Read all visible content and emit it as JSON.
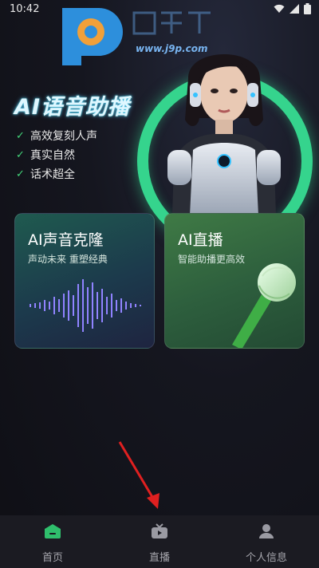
{
  "status_bar": {
    "time": "10:42"
  },
  "watermark": {
    "url": "www.j9p.com"
  },
  "hero": {
    "title": "AI语音助播",
    "features": [
      "高效复刻人声",
      "真实自然",
      "话术超全"
    ]
  },
  "cards": [
    {
      "title": "AI声音克隆",
      "subtitle": "声动未来 重塑经典"
    },
    {
      "title": "AI直播",
      "subtitle": "智能助播更高效"
    }
  ],
  "nav": [
    {
      "label": "首页",
      "icon": "home-icon",
      "active": true
    },
    {
      "label": "直播",
      "icon": "tv-icon",
      "active": false
    },
    {
      "label": "个人信息",
      "icon": "person-icon",
      "active": false
    }
  ],
  "colors": {
    "accent": "#35d48d",
    "check": "#43d47a",
    "nav_active": "#2fbf6c"
  }
}
